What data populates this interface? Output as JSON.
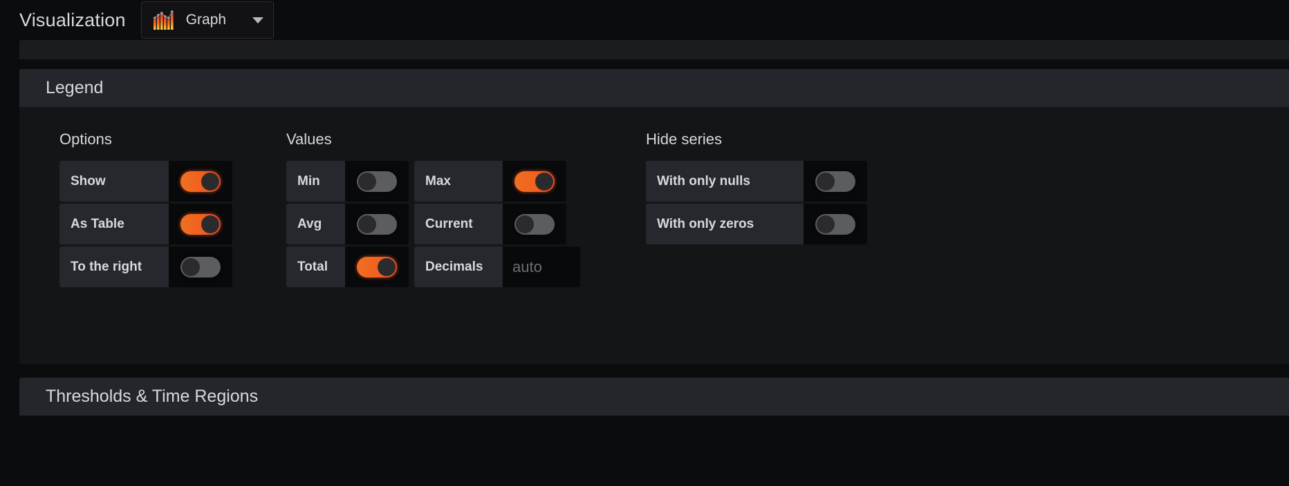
{
  "header": {
    "label": "Visualization",
    "picker": {
      "value": "Graph",
      "icon": "graph-bar-line-icon",
      "caret_icon": "chevron-down-icon"
    }
  },
  "legend_section": {
    "title": "Legend",
    "columns": {
      "options": {
        "heading": "Options",
        "fields": [
          {
            "label": "Show",
            "type": "switch",
            "state": "on"
          },
          {
            "label": "As Table",
            "type": "switch",
            "state": "on"
          },
          {
            "label": "To the right",
            "type": "switch",
            "state": "off"
          }
        ]
      },
      "values": {
        "heading": "Values",
        "left_fields": [
          {
            "label": "Min",
            "type": "switch",
            "state": "off"
          },
          {
            "label": "Avg",
            "type": "switch",
            "state": "off"
          },
          {
            "label": "Total",
            "type": "switch",
            "state": "on"
          }
        ],
        "right_fields": [
          {
            "label": "Max",
            "type": "switch",
            "state": "on"
          },
          {
            "label": "Current",
            "type": "switch",
            "state": "off"
          },
          {
            "label": "Decimals",
            "type": "input",
            "value": "",
            "placeholder": "auto"
          }
        ]
      },
      "hide_series": {
        "heading": "Hide series",
        "fields": [
          {
            "label": "With only nulls",
            "type": "switch",
            "state": "off"
          },
          {
            "label": "With only zeros",
            "type": "switch",
            "state": "off"
          }
        ]
      }
    }
  },
  "thresholds_section": {
    "title": "Thresholds & Time Regions"
  },
  "colors": {
    "accent_on_start": "#ef7022",
    "accent_on_end": "#e8492b",
    "switch_off": "#5c5d60",
    "knob": "#2b2b2d",
    "page_bg": "#0b0c0e",
    "panel_bg": "#141517",
    "panel_head_bg": "#24262b",
    "field_bg": "#26282d",
    "control_bg": "#08090a",
    "text": "#d8d9da",
    "placeholder_text": "#6e7071"
  }
}
